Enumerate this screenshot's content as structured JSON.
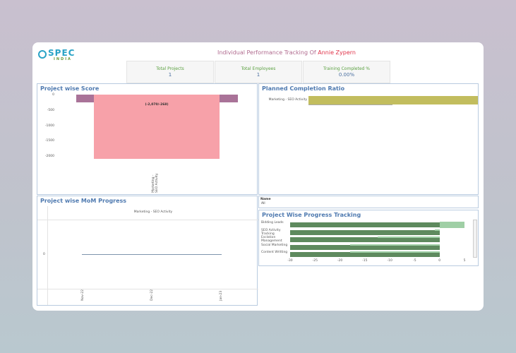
{
  "header": {
    "logo_text": "SPEC",
    "logo_sub": "INDIA",
    "title_prefix": "Individual Performance Tracking Of",
    "title_name": "Annie Zypern"
  },
  "kpis": [
    {
      "label": "Total Projects",
      "value": "1"
    },
    {
      "label": "Total Employees",
      "value": "1"
    },
    {
      "label": "Training Completed %",
      "value": "0.00%"
    }
  ],
  "panels": {
    "score": "Project wise Score",
    "planned": "Planned Completion Ratio",
    "mom": "Project wise MoM Progress",
    "progress": "Project Wise Progress Tracking"
  },
  "filter": {
    "label": "Name",
    "value": "All"
  },
  "chart_data": [
    {
      "type": "bar",
      "title": "Project wise Score",
      "categories": [
        "Marketing - SEO Activity"
      ],
      "series": [
        {
          "values": [
            -268
          ],
          "color": "#a97398"
        },
        {
          "values": [
            -2070
          ],
          "color": "#f7a1a9"
        }
      ],
      "data_label": "(-2,070/-268)",
      "yticks": [
        "0",
        "-500",
        "-1000",
        "-1500",
        "-2000"
      ],
      "ylim": [
        -2100,
        0
      ]
    },
    {
      "type": "bar",
      "orientation": "horizontal",
      "title": "Planned Completion Ratio",
      "categories": [
        "Marketing - SEO Activity"
      ],
      "values": [
        1.0
      ],
      "color": "#c2bd5e"
    },
    {
      "type": "line",
      "title": "Project wise MoM Progress",
      "header": "Marketing - SEO Activity",
      "x": [
        "Nov-22",
        "Dec-22",
        "Jan-23"
      ],
      "values": [
        0,
        0,
        0
      ],
      "yticks": [
        "0"
      ]
    },
    {
      "type": "bar",
      "orientation": "horizontal",
      "title": "Project Wise Progress Tracking",
      "categories": [
        "Bidding Leads",
        "SEO Activity Tracking",
        "Esclation Management",
        "Social Marketing",
        "Content Writting"
      ],
      "series": [
        {
          "values": [
            -30,
            -30,
            -30,
            -30,
            -30
          ],
          "color": "#5e8a5e"
        },
        {
          "values": [
            5,
            -1,
            -12.5,
            -18,
            -18
          ],
          "color": "#9fcfa5"
        }
      ],
      "xticks": [
        "-30",
        "-25",
        "-20",
        "-15",
        "-10",
        "-5",
        "0",
        "5"
      ],
      "xlim": [
        -30,
        5
      ]
    }
  ]
}
